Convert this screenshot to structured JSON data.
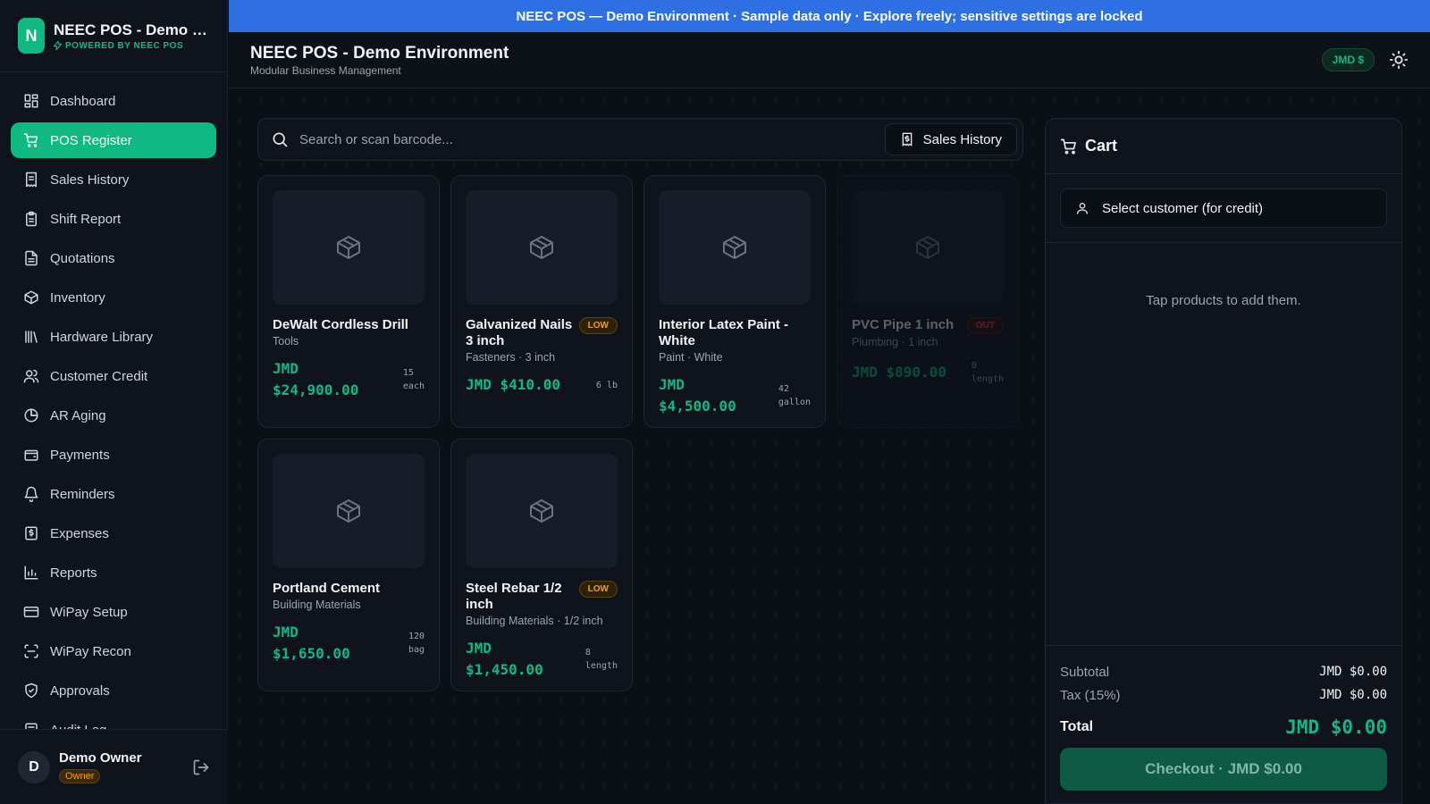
{
  "banner": {
    "text": "NEEC POS — Demo Environment · Sample data only · Explore freely; sensitive settings are locked"
  },
  "brand": {
    "logo_letter": "N",
    "title": "NEEC POS - Demo Environment",
    "subtitle": "POWERED BY NEEC POS"
  },
  "sidebar": {
    "items": [
      {
        "label": "Dashboard",
        "icon": "dashboard-icon",
        "active": false
      },
      {
        "label": "POS Register",
        "icon": "cart-icon",
        "active": true
      },
      {
        "label": "Sales History",
        "icon": "receipt-icon",
        "active": false
      },
      {
        "label": "Shift Report",
        "icon": "clipboard-icon",
        "active": false
      },
      {
        "label": "Quotations",
        "icon": "document-icon",
        "active": false
      },
      {
        "label": "Inventory",
        "icon": "package-icon",
        "active": false
      },
      {
        "label": "Hardware Library",
        "icon": "library-icon",
        "active": false
      },
      {
        "label": "Customer Credit",
        "icon": "users-icon",
        "active": false
      },
      {
        "label": "AR Aging",
        "icon": "pie-chart-icon",
        "active": false
      },
      {
        "label": "Payments",
        "icon": "wallet-icon",
        "active": false
      },
      {
        "label": "Reminders",
        "icon": "bell-icon",
        "active": false
      },
      {
        "label": "Expenses",
        "icon": "dollar-receipt-icon",
        "active": false
      },
      {
        "label": "Reports",
        "icon": "bar-chart-icon",
        "active": false
      },
      {
        "label": "WiPay Setup",
        "icon": "credit-card-icon",
        "active": false
      },
      {
        "label": "WiPay Recon",
        "icon": "scan-icon",
        "active": false
      },
      {
        "label": "Approvals",
        "icon": "shield-icon",
        "active": false
      },
      {
        "label": "Audit Log",
        "icon": "log-icon",
        "active": false
      }
    ]
  },
  "user": {
    "initial": "D",
    "name": "Demo Owner",
    "role": "Owner"
  },
  "header": {
    "title": "NEEC POS - Demo Environment",
    "subtitle": "Modular Business Management",
    "currency": "JMD $"
  },
  "search": {
    "placeholder": "Search or scan barcode...",
    "history_label": "Sales History"
  },
  "products": [
    {
      "name": "DeWalt Cordless Drill",
      "meta": "Tools",
      "price": "JMD $24,900.00",
      "qty": "15 each",
      "badge": "",
      "status": "ok"
    },
    {
      "name": "Galvanized Nails 3 inch",
      "meta": "Fasteners · 3 inch",
      "price": "JMD $410.00",
      "qty": "6 lb",
      "badge": "LOW",
      "status": "low"
    },
    {
      "name": "Interior Latex Paint - White",
      "meta": "Paint · White",
      "price": "JMD $4,500.00",
      "qty": "42 gallon",
      "badge": "",
      "status": "ok"
    },
    {
      "name": "PVC Pipe 1 inch",
      "meta": "Plumbing · 1 inch",
      "price": "JMD $890.00",
      "qty": "0 length",
      "badge": "OUT",
      "status": "out"
    },
    {
      "name": "Portland Cement",
      "meta": "Building Materials",
      "price": "JMD $1,650.00",
      "qty": "120 bag",
      "badge": "",
      "status": "ok"
    },
    {
      "name": "Steel Rebar 1/2 inch",
      "meta": "Building Materials · 1/2 inch",
      "price": "JMD $1,450.00",
      "qty": "8 length",
      "badge": "LOW",
      "status": "low"
    }
  ],
  "cart": {
    "title": "Cart",
    "customer_label": "Select customer (for credit)",
    "empty_text": "Tap products to add them.",
    "subtotal_label": "Subtotal",
    "subtotal": "JMD $0.00",
    "tax_label": "Tax (15%)",
    "tax": "JMD $0.00",
    "total_label": "Total",
    "total": "JMD $0.00",
    "checkout_label": "Checkout · JMD $0.00"
  },
  "colors": {
    "accent": "#10b981",
    "banner": "#2f6fe4",
    "low": "#f59e0b",
    "out": "#ef4444"
  }
}
